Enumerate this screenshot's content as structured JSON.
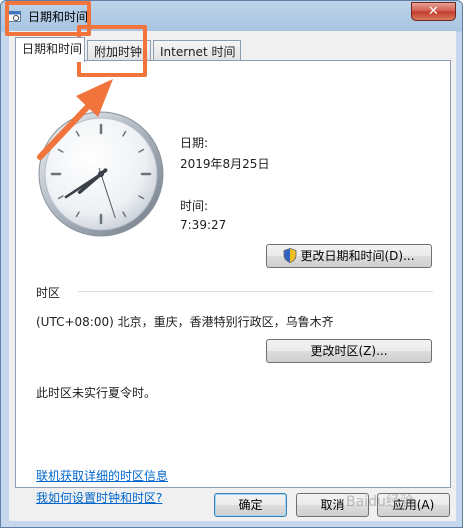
{
  "window": {
    "title": "日期和时间",
    "close_glyph": "✕"
  },
  "tabs": [
    {
      "label": "日期和时间",
      "active": true
    },
    {
      "label": "附加时钟",
      "active": false
    },
    {
      "label": "Internet 时间",
      "active": false
    }
  ],
  "date_section": {
    "date_label": "日期:",
    "date_value": "2019年8月25日",
    "time_label": "时间:",
    "time_value": "7:39:27",
    "clock": {
      "hour": 7,
      "minute": 39,
      "second": 27
    },
    "change_datetime_button": "更改日期和时间(D)..."
  },
  "timezone_section": {
    "header": "时区",
    "current": "(UTC+08:00) 北京，重庆，香港特别行政区，乌鲁木齐",
    "change_timezone_button": "更改时区(Z)...",
    "dst_note": "此时区未实行夏令时。"
  },
  "links": {
    "timezone_info": "联机获取详细的时区信息",
    "how_to": "我如何设置时钟和时区?"
  },
  "footer": {
    "ok": "确定",
    "cancel": "取消",
    "apply": "应用(A)"
  },
  "watermark": "Baidu经验",
  "colors": {
    "highlight": "#f0743c",
    "link": "#0066cc",
    "accent": "#3c7fb1"
  }
}
